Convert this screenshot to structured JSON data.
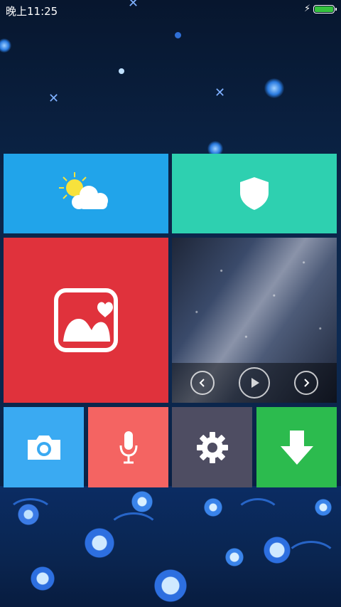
{
  "status_bar": {
    "time": "晚上11:25",
    "charging_icon": "lightning-bolt-icon",
    "battery_icon": "battery-full-icon",
    "battery_color": "#35c23e"
  },
  "tiles": {
    "weather": {
      "icon": "partly-sunny-icon",
      "color": "#21a4ea"
    },
    "security": {
      "icon": "shield-icon",
      "color": "#2ed0b0"
    },
    "gallery": {
      "icon": "gallery-mountain-heart-icon",
      "color": "#e0323c"
    },
    "photos": {
      "controls": [
        "previous-icon",
        "play-icon",
        "next-icon"
      ]
    },
    "camera": {
      "icon": "camera-icon",
      "color": "#3aaaf2"
    },
    "recorder": {
      "icon": "microphone-icon",
      "color": "#f46462"
    },
    "settings": {
      "icon": "gear-icon",
      "color": "#4e4d62"
    },
    "downloads": {
      "icon": "download-arrow-icon",
      "color": "#2cbb4e"
    }
  }
}
